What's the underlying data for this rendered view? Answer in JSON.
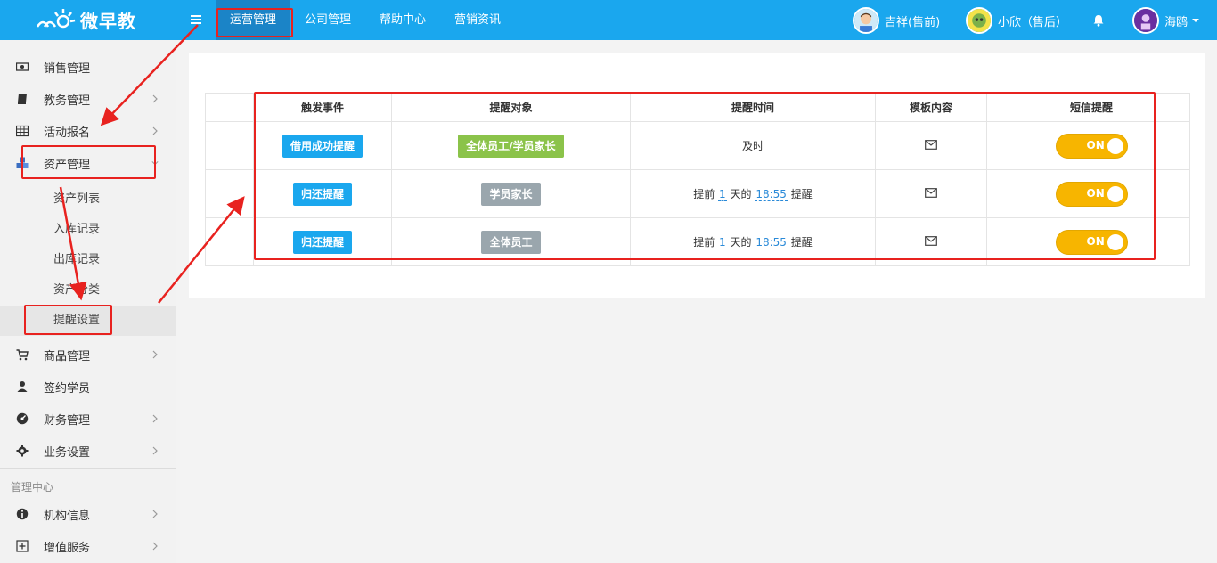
{
  "header": {
    "logo_text": "微早教",
    "nav": [
      {
        "label": "运营管理",
        "active": true
      },
      {
        "label": "公司管理",
        "active": false
      },
      {
        "label": "帮助中心",
        "active": false
      },
      {
        "label": "营销资讯",
        "active": false
      }
    ],
    "users": [
      {
        "name": "吉祥(售前)"
      },
      {
        "name": "小欣（售后）"
      },
      {
        "name": "海鸥"
      }
    ]
  },
  "sidebar": {
    "items": [
      {
        "label": "销售管理",
        "icon": "money-icon"
      },
      {
        "label": "教务管理",
        "icon": "book-icon"
      },
      {
        "label": "活动报名",
        "icon": "table-icon"
      },
      {
        "label": "资产管理",
        "icon": "cubes-icon"
      },
      {
        "label": "商品管理",
        "icon": "cart-icon"
      },
      {
        "label": "签约学员",
        "icon": "user-icon"
      },
      {
        "label": "财务管理",
        "icon": "dashboard-icon"
      },
      {
        "label": "业务设置",
        "icon": "gear-icon"
      },
      {
        "label": "机构信息",
        "icon": "info-icon"
      },
      {
        "label": "增值服务",
        "icon": "plus-square-icon"
      }
    ],
    "asset_sub": [
      {
        "label": "资产列表"
      },
      {
        "label": "入库记录"
      },
      {
        "label": "出库记录"
      },
      {
        "label": "资产分类"
      },
      {
        "label": "提醒设置"
      }
    ],
    "section_label": "管理中心"
  },
  "table": {
    "headers": [
      "触发事件",
      "提醒对象",
      "提醒时间",
      "模板内容",
      "短信提醒"
    ],
    "rows": [
      {
        "event": "借用成功提醒",
        "target": "全体员工/学员家长",
        "target_color": "green",
        "time_text": "及时",
        "sms": "ON"
      },
      {
        "event": "归还提醒",
        "target": "学员家长",
        "target_color": "gray",
        "time_prefix": "提前",
        "days": "1",
        "time_mid": "天的",
        "clock": "18:55",
        "time_suffix": "提醒",
        "sms": "ON"
      },
      {
        "event": "归还提醒",
        "target": "全体员工",
        "target_color": "gray",
        "time_prefix": "提前",
        "days": "1",
        "time_mid": "天的",
        "clock": "18:55",
        "time_suffix": "提醒",
        "sms": "ON"
      }
    ]
  },
  "colors": {
    "topbar": "#1aa7ee",
    "active_nav": "#1b84c7",
    "toggle_on": "#f7b500",
    "annotation": "#e8221f"
  }
}
